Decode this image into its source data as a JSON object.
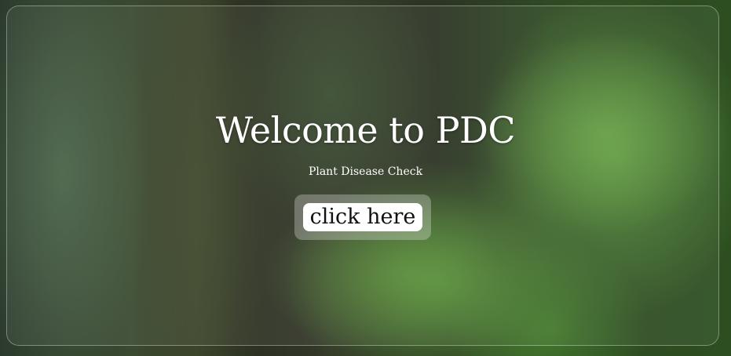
{
  "hero": {
    "title": "Welcome to PDC",
    "subtitle": "Plant Disease Check",
    "cta_label": "click here"
  }
}
